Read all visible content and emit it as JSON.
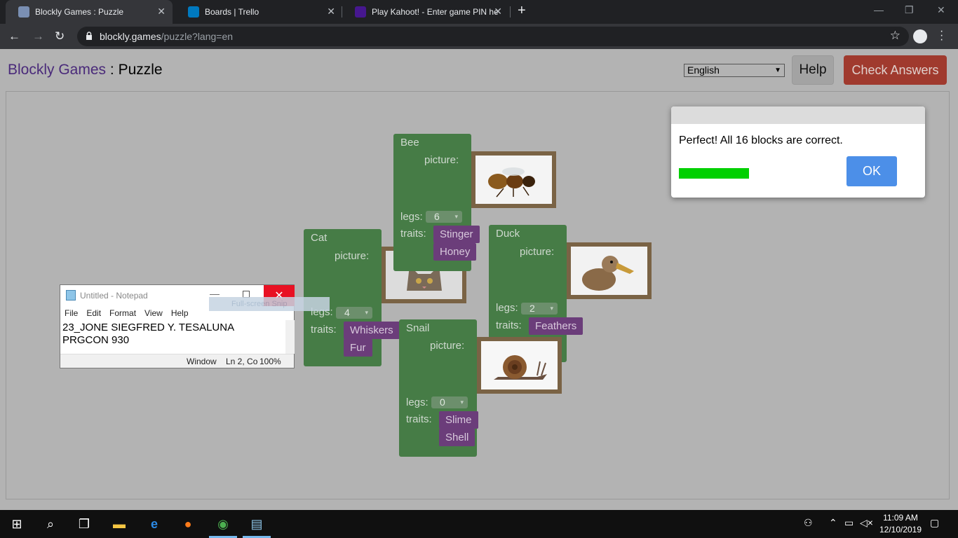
{
  "browser": {
    "tabs": [
      {
        "title": "Blockly Games : Puzzle",
        "active": true,
        "favicon_color": "#7a8fb3"
      },
      {
        "title": "Boards | Trello",
        "active": false,
        "favicon_color": "#0079bf"
      },
      {
        "title": "Play Kahoot! - Enter game PIN he",
        "active": false,
        "favicon_color": "#46178f"
      }
    ],
    "url_host": "blockly.games",
    "url_path": "/puzzle?lang=en"
  },
  "header": {
    "brand": "Blockly Games",
    "sep": " : ",
    "page": "Puzzle",
    "language": "English",
    "help_label": "Help",
    "check_label": "Check Answers"
  },
  "blocks": {
    "bee": {
      "name": "Bee",
      "picture_label": "picture:",
      "legs_label": "legs:",
      "legs": "6",
      "traits_label": "traits:",
      "traits": [
        "Stinger",
        "Honey"
      ]
    },
    "cat": {
      "name": "Cat",
      "picture_label": "picture:",
      "legs_label": "legs:",
      "legs": "4",
      "traits_label": "traits:",
      "traits": [
        "Whiskers",
        "Fur"
      ]
    },
    "duck": {
      "name": "Duck",
      "picture_label": "picture:",
      "legs_label": "legs:",
      "legs": "2",
      "traits_label": "traits:",
      "traits": [
        "Feathers"
      ]
    },
    "snail": {
      "name": "Snail",
      "picture_label": "picture:",
      "legs_label": "legs:",
      "legs": "0",
      "traits_label": "traits:",
      "traits": [
        "Slime",
        "Shell"
      ]
    }
  },
  "dialog": {
    "message": "Perfect! All 16 blocks are correct.",
    "progress": 1.0,
    "ok_label": "OK"
  },
  "notepad": {
    "title": "Untitled - Notepad",
    "menu": [
      "File",
      "Edit",
      "Format",
      "View",
      "Help"
    ],
    "lines": [
      "23_JONE SIEGFRED Y. TESALUNA",
      "PRGCON 930"
    ],
    "status_window": "Window",
    "status_pos": "Ln 2, Co",
    "status_zoom": "100%",
    "ghost_label": "Full-screen Snip"
  },
  "taskbar": {
    "time": "11:09 AM",
    "date": "12/10/2019"
  },
  "colors": {
    "block_green": "#467c46",
    "trait_purple": "#6b3d7a",
    "check_red": "#a03a2e",
    "ok_blue": "#4c8fe8",
    "progress_green": "#00d000"
  }
}
